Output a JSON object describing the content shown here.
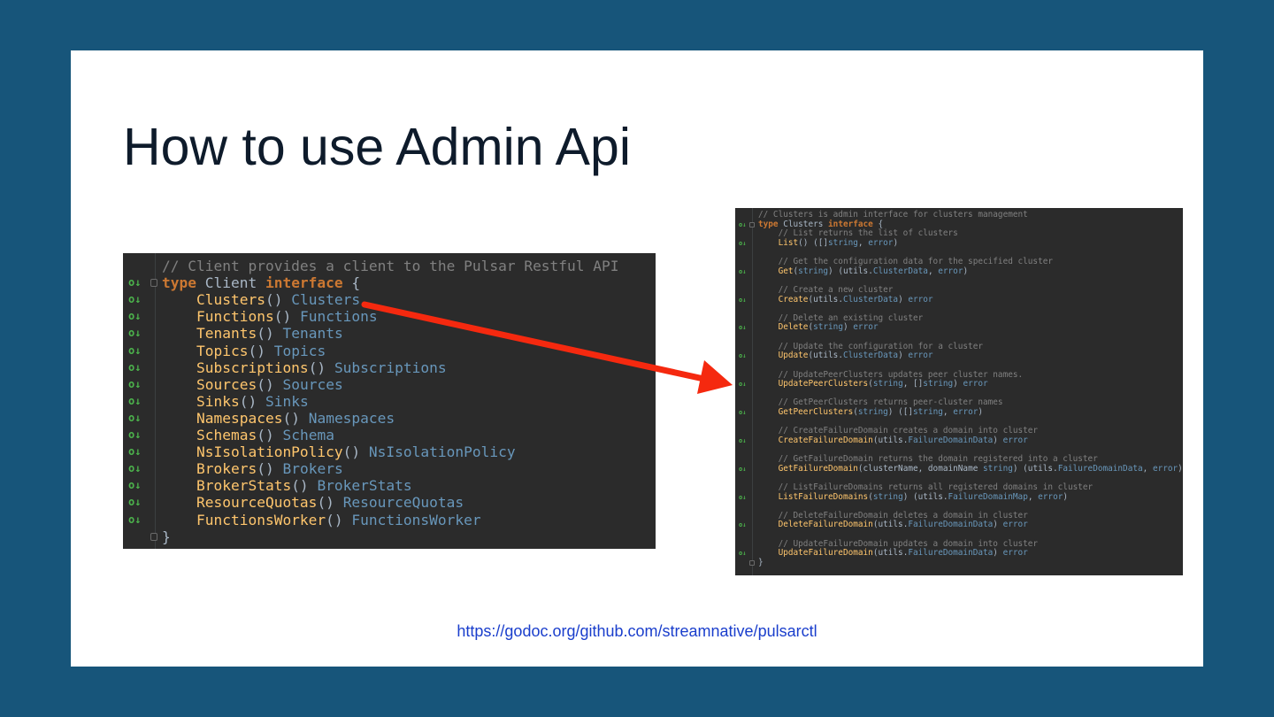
{
  "slide": {
    "title": "How to use Admin Api",
    "link": "https://godoc.org/github.com/streamnative/pulsarctl"
  },
  "left_code": {
    "lines": [
      {
        "gutter": "",
        "fold": false,
        "tokens": [
          {
            "c": "cm",
            "t": "// Client provides a client to the Pulsar Restful API"
          }
        ]
      },
      {
        "gutter": "o↓",
        "fold": true,
        "tokens": [
          {
            "c": "kw",
            "t": "type"
          },
          {
            "c": "pl",
            "t": " Client "
          },
          {
            "c": "kw",
            "t": "interface"
          },
          {
            "c": "pl",
            "t": " {"
          }
        ]
      },
      {
        "gutter": "o↓",
        "fold": false,
        "tokens": [
          {
            "c": "pl",
            "t": "    "
          },
          {
            "c": "fn",
            "t": "Clusters"
          },
          {
            "c": "pl",
            "t": "() "
          },
          {
            "c": "ty",
            "t": "Clusters"
          }
        ]
      },
      {
        "gutter": "o↓",
        "fold": false,
        "tokens": [
          {
            "c": "pl",
            "t": "    "
          },
          {
            "c": "fn",
            "t": "Functions"
          },
          {
            "c": "pl",
            "t": "() "
          },
          {
            "c": "ty",
            "t": "Functions"
          }
        ]
      },
      {
        "gutter": "o↓",
        "fold": false,
        "tokens": [
          {
            "c": "pl",
            "t": "    "
          },
          {
            "c": "fn",
            "t": "Tenants"
          },
          {
            "c": "pl",
            "t": "() "
          },
          {
            "c": "ty",
            "t": "Tenants"
          }
        ]
      },
      {
        "gutter": "o↓",
        "fold": false,
        "tokens": [
          {
            "c": "pl",
            "t": "    "
          },
          {
            "c": "fn",
            "t": "Topics"
          },
          {
            "c": "pl",
            "t": "() "
          },
          {
            "c": "ty",
            "t": "Topics"
          }
        ]
      },
      {
        "gutter": "o↓",
        "fold": false,
        "tokens": [
          {
            "c": "pl",
            "t": "    "
          },
          {
            "c": "fn",
            "t": "Subscriptions"
          },
          {
            "c": "pl",
            "t": "() "
          },
          {
            "c": "ty",
            "t": "Subscriptions"
          }
        ]
      },
      {
        "gutter": "o↓",
        "fold": false,
        "tokens": [
          {
            "c": "pl",
            "t": "    "
          },
          {
            "c": "fn",
            "t": "Sources"
          },
          {
            "c": "pl",
            "t": "() "
          },
          {
            "c": "ty",
            "t": "Sources"
          }
        ]
      },
      {
        "gutter": "o↓",
        "fold": false,
        "tokens": [
          {
            "c": "pl",
            "t": "    "
          },
          {
            "c": "fn",
            "t": "Sinks"
          },
          {
            "c": "pl",
            "t": "() "
          },
          {
            "c": "ty",
            "t": "Sinks"
          }
        ]
      },
      {
        "gutter": "o↓",
        "fold": false,
        "tokens": [
          {
            "c": "pl",
            "t": "    "
          },
          {
            "c": "fn",
            "t": "Namespaces"
          },
          {
            "c": "pl",
            "t": "() "
          },
          {
            "c": "ty",
            "t": "Namespaces"
          }
        ]
      },
      {
        "gutter": "o↓",
        "fold": false,
        "tokens": [
          {
            "c": "pl",
            "t": "    "
          },
          {
            "c": "fn",
            "t": "Schemas"
          },
          {
            "c": "pl",
            "t": "() "
          },
          {
            "c": "ty",
            "t": "Schema"
          }
        ]
      },
      {
        "gutter": "o↓",
        "fold": false,
        "tokens": [
          {
            "c": "pl",
            "t": "    "
          },
          {
            "c": "fn",
            "t": "NsIsolationPolicy"
          },
          {
            "c": "pl",
            "t": "() "
          },
          {
            "c": "ty",
            "t": "NsIsolationPolicy"
          }
        ]
      },
      {
        "gutter": "o↓",
        "fold": false,
        "tokens": [
          {
            "c": "pl",
            "t": "    "
          },
          {
            "c": "fn",
            "t": "Brokers"
          },
          {
            "c": "pl",
            "t": "() "
          },
          {
            "c": "ty",
            "t": "Brokers"
          }
        ]
      },
      {
        "gutter": "o↓",
        "fold": false,
        "tokens": [
          {
            "c": "pl",
            "t": "    "
          },
          {
            "c": "fn",
            "t": "BrokerStats"
          },
          {
            "c": "pl",
            "t": "() "
          },
          {
            "c": "ty",
            "t": "BrokerStats"
          }
        ]
      },
      {
        "gutter": "o↓",
        "fold": false,
        "tokens": [
          {
            "c": "pl",
            "t": "    "
          },
          {
            "c": "fn",
            "t": "ResourceQuotas"
          },
          {
            "c": "pl",
            "t": "() "
          },
          {
            "c": "ty",
            "t": "ResourceQuotas"
          }
        ]
      },
      {
        "gutter": "o↓",
        "fold": false,
        "tokens": [
          {
            "c": "pl",
            "t": "    "
          },
          {
            "c": "fn",
            "t": "FunctionsWorker"
          },
          {
            "c": "pl",
            "t": "() "
          },
          {
            "c": "ty",
            "t": "FunctionsWorker"
          }
        ]
      },
      {
        "gutter": "",
        "fold": true,
        "tokens": [
          {
            "c": "pl",
            "t": "}"
          }
        ]
      }
    ]
  },
  "right_code": {
    "lines": [
      {
        "gutter": "",
        "fold": false,
        "tokens": [
          {
            "c": "cm",
            "t": "// Clusters is admin interface for clusters management"
          }
        ]
      },
      {
        "gutter": "o↓",
        "fold": true,
        "tokens": [
          {
            "c": "kw",
            "t": "type"
          },
          {
            "c": "pl",
            "t": " Clusters "
          },
          {
            "c": "kw",
            "t": "interface"
          },
          {
            "c": "pl",
            "t": " {"
          }
        ]
      },
      {
        "gutter": "",
        "fold": false,
        "tokens": [
          {
            "c": "cm",
            "t": "    // List returns the list of clusters"
          }
        ]
      },
      {
        "gutter": "o↓",
        "fold": false,
        "tokens": [
          {
            "c": "pl",
            "t": "    "
          },
          {
            "c": "fn",
            "t": "List"
          },
          {
            "c": "pl",
            "t": "() ([]"
          },
          {
            "c": "ty",
            "t": "string"
          },
          {
            "c": "pl",
            "t": ", "
          },
          {
            "c": "ty",
            "t": "error"
          },
          {
            "c": "pl",
            "t": ")"
          }
        ]
      },
      {
        "gutter": "",
        "fold": false,
        "tokens": []
      },
      {
        "gutter": "",
        "fold": false,
        "tokens": [
          {
            "c": "cm",
            "t": "    // Get the configuration data for the specified cluster"
          }
        ]
      },
      {
        "gutter": "o↓",
        "fold": false,
        "tokens": [
          {
            "c": "pl",
            "t": "    "
          },
          {
            "c": "fn",
            "t": "Get"
          },
          {
            "c": "pl",
            "t": "("
          },
          {
            "c": "ty",
            "t": "string"
          },
          {
            "c": "pl",
            "t": ") (utils."
          },
          {
            "c": "ty",
            "t": "ClusterData"
          },
          {
            "c": "pl",
            "t": ", "
          },
          {
            "c": "ty",
            "t": "error"
          },
          {
            "c": "pl",
            "t": ")"
          }
        ]
      },
      {
        "gutter": "",
        "fold": false,
        "tokens": []
      },
      {
        "gutter": "",
        "fold": false,
        "tokens": [
          {
            "c": "cm",
            "t": "    // Create a new cluster"
          }
        ]
      },
      {
        "gutter": "o↓",
        "fold": false,
        "tokens": [
          {
            "c": "pl",
            "t": "    "
          },
          {
            "c": "fn",
            "t": "Create"
          },
          {
            "c": "pl",
            "t": "(utils."
          },
          {
            "c": "ty",
            "t": "ClusterData"
          },
          {
            "c": "pl",
            "t": ") "
          },
          {
            "c": "ty",
            "t": "error"
          }
        ]
      },
      {
        "gutter": "",
        "fold": false,
        "tokens": []
      },
      {
        "gutter": "",
        "fold": false,
        "tokens": [
          {
            "c": "cm",
            "t": "    // Delete an existing cluster"
          }
        ]
      },
      {
        "gutter": "o↓",
        "fold": false,
        "tokens": [
          {
            "c": "pl",
            "t": "    "
          },
          {
            "c": "fn",
            "t": "Delete"
          },
          {
            "c": "pl",
            "t": "("
          },
          {
            "c": "ty",
            "t": "string"
          },
          {
            "c": "pl",
            "t": ") "
          },
          {
            "c": "ty",
            "t": "error"
          }
        ]
      },
      {
        "gutter": "",
        "fold": false,
        "tokens": []
      },
      {
        "gutter": "",
        "fold": false,
        "tokens": [
          {
            "c": "cm",
            "t": "    // Update the configuration for a cluster"
          }
        ]
      },
      {
        "gutter": "o↓",
        "fold": false,
        "tokens": [
          {
            "c": "pl",
            "t": "    "
          },
          {
            "c": "fn",
            "t": "Update"
          },
          {
            "c": "pl",
            "t": "(utils."
          },
          {
            "c": "ty",
            "t": "ClusterData"
          },
          {
            "c": "pl",
            "t": ") "
          },
          {
            "c": "ty",
            "t": "error"
          }
        ]
      },
      {
        "gutter": "",
        "fold": false,
        "tokens": []
      },
      {
        "gutter": "",
        "fold": false,
        "tokens": [
          {
            "c": "cm",
            "t": "    // UpdatePeerClusters updates peer cluster names."
          }
        ]
      },
      {
        "gutter": "o↓",
        "fold": false,
        "tokens": [
          {
            "c": "pl",
            "t": "    "
          },
          {
            "c": "fn",
            "t": "UpdatePeerClusters"
          },
          {
            "c": "pl",
            "t": "("
          },
          {
            "c": "ty",
            "t": "string"
          },
          {
            "c": "pl",
            "t": ", []"
          },
          {
            "c": "ty",
            "t": "string"
          },
          {
            "c": "pl",
            "t": ") "
          },
          {
            "c": "ty",
            "t": "error"
          }
        ]
      },
      {
        "gutter": "",
        "fold": false,
        "tokens": []
      },
      {
        "gutter": "",
        "fold": false,
        "tokens": [
          {
            "c": "cm",
            "t": "    // GetPeerClusters returns peer-cluster names"
          }
        ]
      },
      {
        "gutter": "o↓",
        "fold": false,
        "tokens": [
          {
            "c": "pl",
            "t": "    "
          },
          {
            "c": "fn",
            "t": "GetPeerClusters"
          },
          {
            "c": "pl",
            "t": "("
          },
          {
            "c": "ty",
            "t": "string"
          },
          {
            "c": "pl",
            "t": ") ([]"
          },
          {
            "c": "ty",
            "t": "string"
          },
          {
            "c": "pl",
            "t": ", "
          },
          {
            "c": "ty",
            "t": "error"
          },
          {
            "c": "pl",
            "t": ")"
          }
        ]
      },
      {
        "gutter": "",
        "fold": false,
        "tokens": []
      },
      {
        "gutter": "",
        "fold": false,
        "tokens": [
          {
            "c": "cm",
            "t": "    // CreateFailureDomain creates a domain into cluster"
          }
        ]
      },
      {
        "gutter": "o↓",
        "fold": false,
        "tokens": [
          {
            "c": "pl",
            "t": "    "
          },
          {
            "c": "fn",
            "t": "CreateFailureDomain"
          },
          {
            "c": "pl",
            "t": "(utils."
          },
          {
            "c": "ty",
            "t": "FailureDomainData"
          },
          {
            "c": "pl",
            "t": ") "
          },
          {
            "c": "ty",
            "t": "error"
          }
        ]
      },
      {
        "gutter": "",
        "fold": false,
        "tokens": []
      },
      {
        "gutter": "",
        "fold": false,
        "tokens": [
          {
            "c": "cm",
            "t": "    // GetFailureDomain returns the domain registered into a cluster"
          }
        ]
      },
      {
        "gutter": "o↓",
        "fold": false,
        "tokens": [
          {
            "c": "pl",
            "t": "    "
          },
          {
            "c": "fn",
            "t": "GetFailureDomain"
          },
          {
            "c": "pl",
            "t": "(clusterName, domainName "
          },
          {
            "c": "ty",
            "t": "string"
          },
          {
            "c": "pl",
            "t": ") (utils."
          },
          {
            "c": "ty",
            "t": "FailureDomainData"
          },
          {
            "c": "pl",
            "t": ", "
          },
          {
            "c": "ty",
            "t": "error"
          },
          {
            "c": "pl",
            "t": ")"
          }
        ]
      },
      {
        "gutter": "",
        "fold": false,
        "tokens": []
      },
      {
        "gutter": "",
        "fold": false,
        "tokens": [
          {
            "c": "cm",
            "t": "    // ListFailureDomains returns all registered domains in cluster"
          }
        ]
      },
      {
        "gutter": "o↓",
        "fold": false,
        "tokens": [
          {
            "c": "pl",
            "t": "    "
          },
          {
            "c": "fn",
            "t": "ListFailureDomains"
          },
          {
            "c": "pl",
            "t": "("
          },
          {
            "c": "ty",
            "t": "string"
          },
          {
            "c": "pl",
            "t": ") (utils."
          },
          {
            "c": "ty",
            "t": "FailureDomainMap"
          },
          {
            "c": "pl",
            "t": ", "
          },
          {
            "c": "ty",
            "t": "error"
          },
          {
            "c": "pl",
            "t": ")"
          }
        ]
      },
      {
        "gutter": "",
        "fold": false,
        "tokens": []
      },
      {
        "gutter": "",
        "fold": false,
        "tokens": [
          {
            "c": "cm",
            "t": "    // DeleteFailureDomain deletes a domain in cluster"
          }
        ]
      },
      {
        "gutter": "o↓",
        "fold": false,
        "tokens": [
          {
            "c": "pl",
            "t": "    "
          },
          {
            "c": "fn",
            "t": "DeleteFailureDomain"
          },
          {
            "c": "pl",
            "t": "(utils."
          },
          {
            "c": "ty",
            "t": "FailureDomainData"
          },
          {
            "c": "pl",
            "t": ") "
          },
          {
            "c": "ty",
            "t": "error"
          }
        ]
      },
      {
        "gutter": "",
        "fold": false,
        "tokens": []
      },
      {
        "gutter": "",
        "fold": false,
        "tokens": [
          {
            "c": "cm",
            "t": "    // UpdateFailureDomain updates a domain into cluster"
          }
        ]
      },
      {
        "gutter": "o↓",
        "fold": false,
        "tokens": [
          {
            "c": "pl",
            "t": "    "
          },
          {
            "c": "fn",
            "t": "UpdateFailureDomain"
          },
          {
            "c": "pl",
            "t": "(utils."
          },
          {
            "c": "ty",
            "t": "FailureDomainData"
          },
          {
            "c": "pl",
            "t": ") "
          },
          {
            "c": "ty",
            "t": "error"
          }
        ]
      },
      {
        "gutter": "",
        "fold": true,
        "tokens": [
          {
            "c": "pl",
            "t": "}"
          }
        ]
      }
    ]
  },
  "colors": {
    "background": "#17557a",
    "slide": "#ffffff",
    "code_bg": "#2b2b2b",
    "arrow": "#f5290f",
    "link": "#1a3ecc"
  },
  "icons": {
    "gutter_marker": "implemented-method-icon",
    "fold": "fold-marker-icon",
    "arrow": "pointer-arrow-icon"
  }
}
